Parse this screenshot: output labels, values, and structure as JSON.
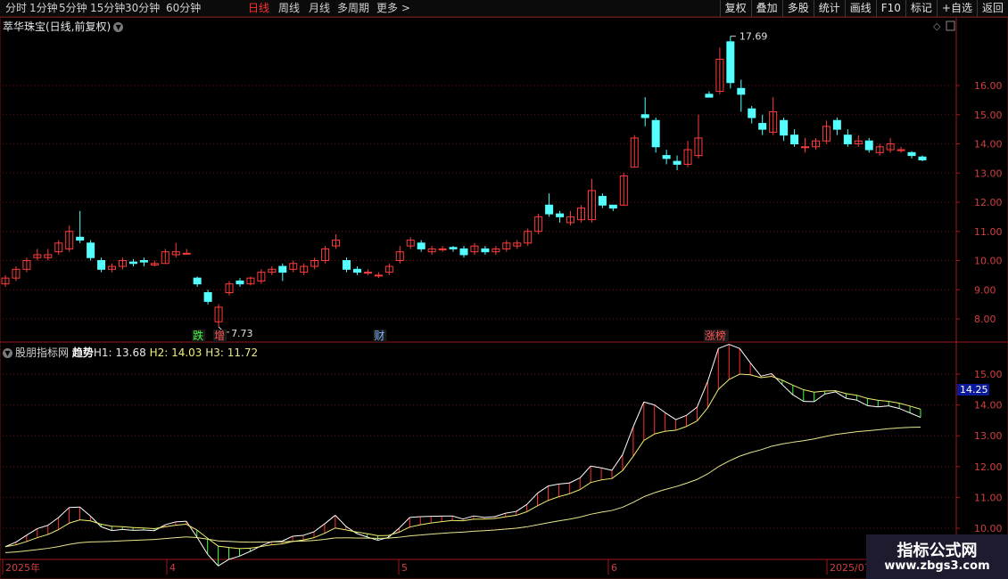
{
  "toolbar": {
    "periods": [
      {
        "label": "分时",
        "active": false
      },
      {
        "label": "1分钟",
        "active": false
      },
      {
        "label": "5分钟",
        "active": false
      },
      {
        "label": "15分钟",
        "active": false
      },
      {
        "label": "30分钟",
        "active": false
      },
      {
        "label": "60分钟",
        "active": false
      },
      {
        "label": "日线",
        "active": true
      },
      {
        "label": "周线",
        "active": false
      },
      {
        "label": "月线",
        "active": false
      },
      {
        "label": "多周期",
        "active": false
      },
      {
        "label": "更多 >",
        "active": false
      }
    ],
    "buttons": [
      "复权",
      "叠加",
      "多股",
      "统计",
      "画线",
      "F10",
      "标记",
      "+自选",
      "返回"
    ]
  },
  "stock": {
    "title": "萃华珠宝(日线,前复权)"
  },
  "price_chart": {
    "y_ticks": [
      "8.00",
      "9.00",
      "10.00",
      "11.00",
      "12.00",
      "13.00",
      "14.00",
      "15.00",
      "16.00"
    ],
    "high_label": "17.69",
    "low_label": "7.73",
    "markers": [
      {
        "text": "跌",
        "color": "#3cff3c"
      },
      {
        "text": "增",
        "color": "#ff5050"
      },
      {
        "text": "财",
        "color": "#7fb4ff"
      },
      {
        "text": "涨榜",
        "color": "#ff5050"
      }
    ],
    "colors": {
      "up": "#ff3c3c",
      "down": "#54ffff",
      "grid": "#6e1010"
    }
  },
  "indicator": {
    "name": "股朋指标网",
    "trend_label": "趋势",
    "h1": "H1: 13.68",
    "h2": "H2: 14.03",
    "h3": "H3: 11.72",
    "y_ticks": [
      "10.00",
      "11.00",
      "12.00",
      "13.00",
      "14.00",
      "15.00"
    ],
    "current_value": "14.25"
  },
  "x_axis": {
    "labels": [
      "2025年",
      "4",
      "5",
      "6",
      "2025/07"
    ]
  },
  "watermark": {
    "title": "指标公式网",
    "url": "www.zbgs3.com"
  },
  "chart_data": {
    "type": "candlestick",
    "title": "萃华珠宝(日线,前复权)",
    "y_range": [
      7.4,
      17.9
    ],
    "candles": [
      [
        9.2,
        9.4,
        9.1,
        9.5
      ],
      [
        9.4,
        9.7,
        9.3,
        9.8
      ],
      [
        9.7,
        10.0,
        9.6,
        10.1
      ],
      [
        10.1,
        10.2,
        10.0,
        10.4
      ],
      [
        10.1,
        10.2,
        10.0,
        10.4
      ],
      [
        10.3,
        10.6,
        10.2,
        10.7
      ],
      [
        10.4,
        11.0,
        10.3,
        11.2
      ],
      [
        10.8,
        10.7,
        10.6,
        11.7
      ],
      [
        10.6,
        10.1,
        10.0,
        10.7
      ],
      [
        10.0,
        9.7,
        9.6,
        10.1
      ],
      [
        9.7,
        9.8,
        9.6,
        9.9
      ],
      [
        9.8,
        10.0,
        9.7,
        10.1
      ],
      [
        9.95,
        9.9,
        9.8,
        10.05
      ],
      [
        10.0,
        9.95,
        9.8,
        10.1
      ],
      [
        9.85,
        9.9,
        9.8,
        10.0
      ],
      [
        9.9,
        10.3,
        9.9,
        10.4
      ],
      [
        10.2,
        10.3,
        10.1,
        10.6
      ],
      [
        10.25,
        10.25,
        10.2,
        10.4
      ],
      [
        9.4,
        9.2,
        9.1,
        9.45
      ],
      [
        8.9,
        8.6,
        8.5,
        9.0
      ],
      [
        7.9,
        8.4,
        7.73,
        8.5
      ],
      [
        8.9,
        9.2,
        8.8,
        9.3
      ],
      [
        9.3,
        9.2,
        9.1,
        9.4
      ],
      [
        9.2,
        9.4,
        9.15,
        9.45
      ],
      [
        9.3,
        9.6,
        9.2,
        9.7
      ],
      [
        9.6,
        9.7,
        9.5,
        9.8
      ],
      [
        9.8,
        9.6,
        9.3,
        9.9
      ],
      [
        9.7,
        9.9,
        9.6,
        10.0
      ],
      [
        9.6,
        9.8,
        9.5,
        9.9
      ],
      [
        9.8,
        10.0,
        9.7,
        10.1
      ],
      [
        10.0,
        10.4,
        9.9,
        10.5
      ],
      [
        10.5,
        10.7,
        10.4,
        10.9
      ],
      [
        10.0,
        9.7,
        9.6,
        10.1
      ],
      [
        9.7,
        9.6,
        9.5,
        9.8
      ],
      [
        9.6,
        9.6,
        9.5,
        9.7
      ],
      [
        9.5,
        9.5,
        9.4,
        9.6
      ],
      [
        9.6,
        9.8,
        9.5,
        9.9
      ],
      [
        10.0,
        10.3,
        9.9,
        10.5
      ],
      [
        10.5,
        10.7,
        10.4,
        10.8
      ],
      [
        10.6,
        10.4,
        10.3,
        10.7
      ],
      [
        10.3,
        10.4,
        10.2,
        10.5
      ],
      [
        10.4,
        10.4,
        10.3,
        10.5
      ],
      [
        10.45,
        10.4,
        10.3,
        10.5
      ],
      [
        10.4,
        10.2,
        10.1,
        10.5
      ],
      [
        10.3,
        10.5,
        10.2,
        10.6
      ],
      [
        10.4,
        10.3,
        10.2,
        10.5
      ],
      [
        10.3,
        10.4,
        10.2,
        10.5
      ],
      [
        10.4,
        10.6,
        10.3,
        10.7
      ],
      [
        10.5,
        10.6,
        10.4,
        10.7
      ],
      [
        10.6,
        11.0,
        10.5,
        11.1
      ],
      [
        11.0,
        11.5,
        10.9,
        11.6
      ],
      [
        11.9,
        11.6,
        11.5,
        12.3
      ],
      [
        11.6,
        11.5,
        11.3,
        11.7
      ],
      [
        11.3,
        11.5,
        11.2,
        11.7
      ],
      [
        11.4,
        11.8,
        11.3,
        11.9
      ],
      [
        11.4,
        12.4,
        11.3,
        12.8
      ],
      [
        12.2,
        11.9,
        11.8,
        12.3
      ],
      [
        11.9,
        11.8,
        11.7,
        11.9
      ],
      [
        11.9,
        12.9,
        11.9,
        13.0
      ],
      [
        13.2,
        14.2,
        13.2,
        14.3
      ],
      [
        15.0,
        14.9,
        14.6,
        15.6
      ],
      [
        14.8,
        13.9,
        13.7,
        14.9
      ],
      [
        13.6,
        13.5,
        13.3,
        13.8
      ],
      [
        13.4,
        13.3,
        13.1,
        13.6
      ],
      [
        13.3,
        13.8,
        13.2,
        14.1
      ],
      [
        13.6,
        14.2,
        13.5,
        15.0
      ],
      [
        15.7,
        15.6,
        15.6,
        15.8
      ],
      [
        15.8,
        16.9,
        15.7,
        17.3
      ],
      [
        17.5,
        16.1,
        15.9,
        17.69
      ],
      [
        15.9,
        15.7,
        15.1,
        16.2
      ],
      [
        15.2,
        14.9,
        14.7,
        15.3
      ],
      [
        14.7,
        14.5,
        14.3,
        15.0
      ],
      [
        14.4,
        15.1,
        14.3,
        15.6
      ],
      [
        14.8,
        14.3,
        14.1,
        14.9
      ],
      [
        14.3,
        14.0,
        13.9,
        14.5
      ],
      [
        13.9,
        13.9,
        13.7,
        14.2
      ],
      [
        13.9,
        14.1,
        13.8,
        14.2
      ],
      [
        14.1,
        14.6,
        14.0,
        14.8
      ],
      [
        14.8,
        14.5,
        14.3,
        14.9
      ],
      [
        14.3,
        14.0,
        13.9,
        14.5
      ],
      [
        14.0,
        14.1,
        13.9,
        14.3
      ],
      [
        14.1,
        13.8,
        13.7,
        14.2
      ],
      [
        13.7,
        13.9,
        13.6,
        14.0
      ],
      [
        13.8,
        14.0,
        13.7,
        14.2
      ],
      [
        13.8,
        13.8,
        13.7,
        13.9
      ],
      [
        13.7,
        13.6,
        13.5,
        13.75
      ],
      [
        13.55,
        13.45,
        13.4,
        13.6
      ]
    ],
    "indicator_series": [
      {
        "name": "H1",
        "last": 13.68
      },
      {
        "name": "H2",
        "last": 14.03
      },
      {
        "name": "H3",
        "last": 11.72
      }
    ]
  }
}
